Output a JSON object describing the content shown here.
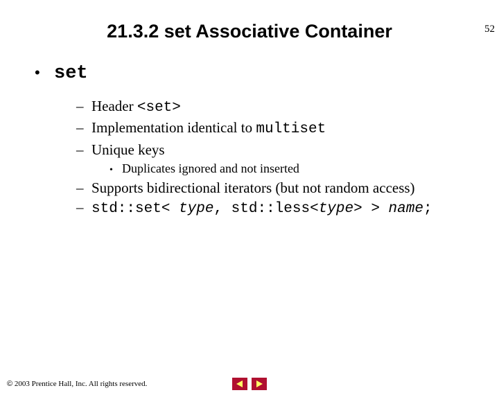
{
  "page_number": "52",
  "title": "21.3.2 set Associative Container",
  "bullet_main": "set",
  "items": {
    "header_prefix": "Header ",
    "header_code": "<set>",
    "impl_prefix": "Implementation identical to ",
    "impl_code": "multiset",
    "unique": "Unique keys",
    "dup": "Duplicates ignored and not inserted",
    "iter": "Supports bidirectional iterators (but not random access)",
    "decl": "std::set< ",
    "decl_type1": "type",
    "decl_mid": ", std::less<",
    "decl_type2": "type",
    "decl_end": "> > ",
    "decl_name": "name",
    "decl_semi": ";"
  },
  "footer": {
    "copyright": " 2003 Prentice Hall, Inc. All rights reserved."
  }
}
